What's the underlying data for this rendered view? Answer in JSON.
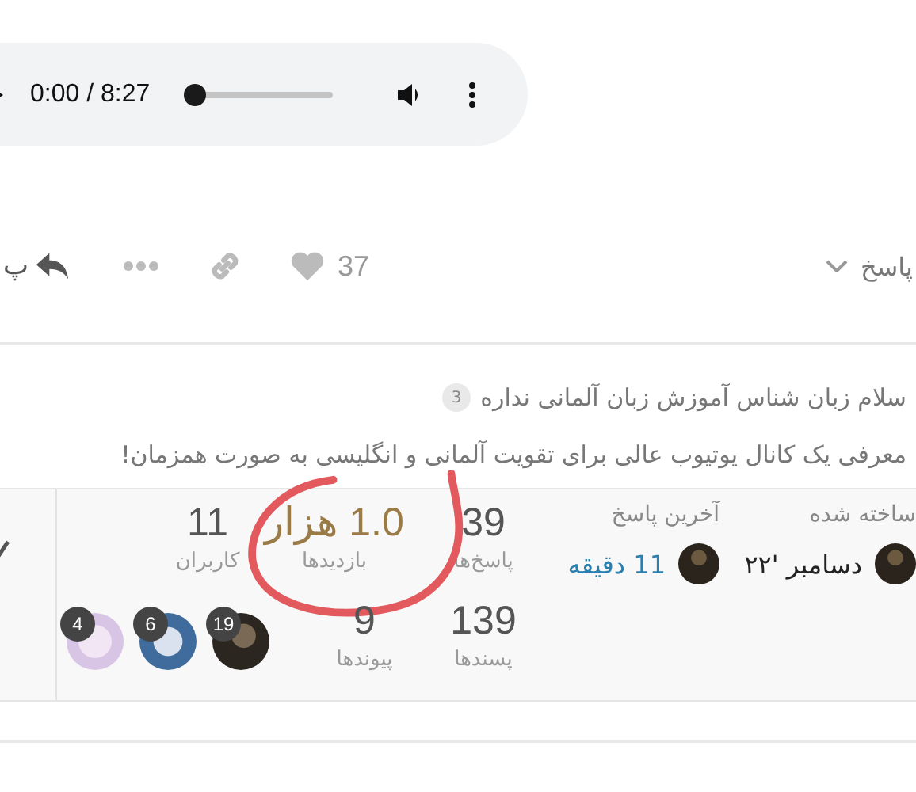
{
  "audio_player": {
    "time": "0:00 / 8:27",
    "level": 0
  },
  "post_actions": {
    "reply_menu": "پاسخ",
    "likes": "37",
    "reply_button": "پ"
  },
  "related_topics": [
    {
      "title": "سلام زبان شناس آموزش زبان آلمانی نداره",
      "count": "3"
    },
    {
      "title": "معرفی یک کانال یوتیوب عالی برای تقویت آلمانی و انگلیسی به صورت همزمان!"
    }
  ],
  "topic_stats": {
    "created": {
      "label": "ساخته شده",
      "value": "دسامبر '۲۲"
    },
    "last_reply": {
      "label": "آخرین پاسخ",
      "value": "11 دقیقه"
    },
    "stats": [
      {
        "kind": "replies",
        "value": "39",
        "label": "پاسخ‌ها",
        "hot": false
      },
      {
        "kind": "views",
        "value": "1.0 هزار",
        "label": "بازدیدها",
        "hot": true,
        "circled": true
      },
      {
        "kind": "users",
        "value": "11",
        "label": "کاربران",
        "hot": false
      },
      {
        "kind": "likes",
        "value": "139",
        "label": "پسندها",
        "hot": false
      },
      {
        "kind": "links",
        "value": "9",
        "label": "پیوندها",
        "hot": false
      }
    ],
    "participants": [
      {
        "count": "19"
      },
      {
        "count": "6"
      },
      {
        "count": "4"
      }
    ]
  }
}
